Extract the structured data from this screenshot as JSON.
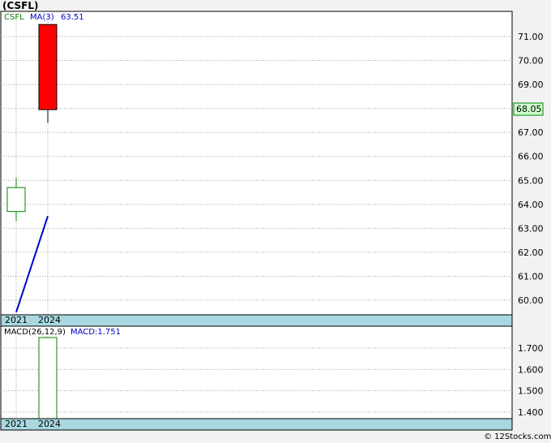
{
  "title": "(CSFL)",
  "credit": "© 12Stocks.com",
  "chart_data": [
    {
      "type": "candlestick",
      "ticker_label": "CSFL",
      "ma_label": "MA(3)",
      "ma_value": "63.51",
      "last_price": "68.05",
      "categories": [
        "2021",
        "2024"
      ],
      "candles": [
        {
          "x": "2021",
          "open": 63.7,
          "high": 65.1,
          "low": 63.3,
          "close": 64.7,
          "direction": "up"
        },
        {
          "x": "2024",
          "open": 71.5,
          "high": 71.5,
          "low": 67.4,
          "close": 67.95,
          "direction": "down"
        }
      ],
      "ma_series": [
        {
          "x": "2021",
          "y": 59.5
        },
        {
          "x": "2024",
          "y": 63.51
        }
      ],
      "yticks": [
        "60.00",
        "61.00",
        "62.00",
        "63.00",
        "64.00",
        "65.00",
        "66.00",
        "67.00",
        "68.00",
        "69.00",
        "70.00",
        "71.00"
      ],
      "ylim": [
        59.5,
        72.0
      ],
      "grid": true,
      "colors": {
        "up": "#008000",
        "down": "#ff0000",
        "ma": "#0000cc",
        "last_price_bg": "#ccffcc",
        "axis_band": "#a8d8e0"
      }
    },
    {
      "type": "bar",
      "label": "MACD(26,12,9)",
      "value_label": "MACD:1.751",
      "categories": [
        "2021",
        "2024"
      ],
      "values": [
        null,
        1.751
      ],
      "yticks": [
        "1.400",
        "1.500",
        "1.600",
        "1.700"
      ],
      "ylim": [
        1.36,
        1.78
      ],
      "grid": true,
      "colors": {
        "bar": "#008000"
      }
    }
  ]
}
